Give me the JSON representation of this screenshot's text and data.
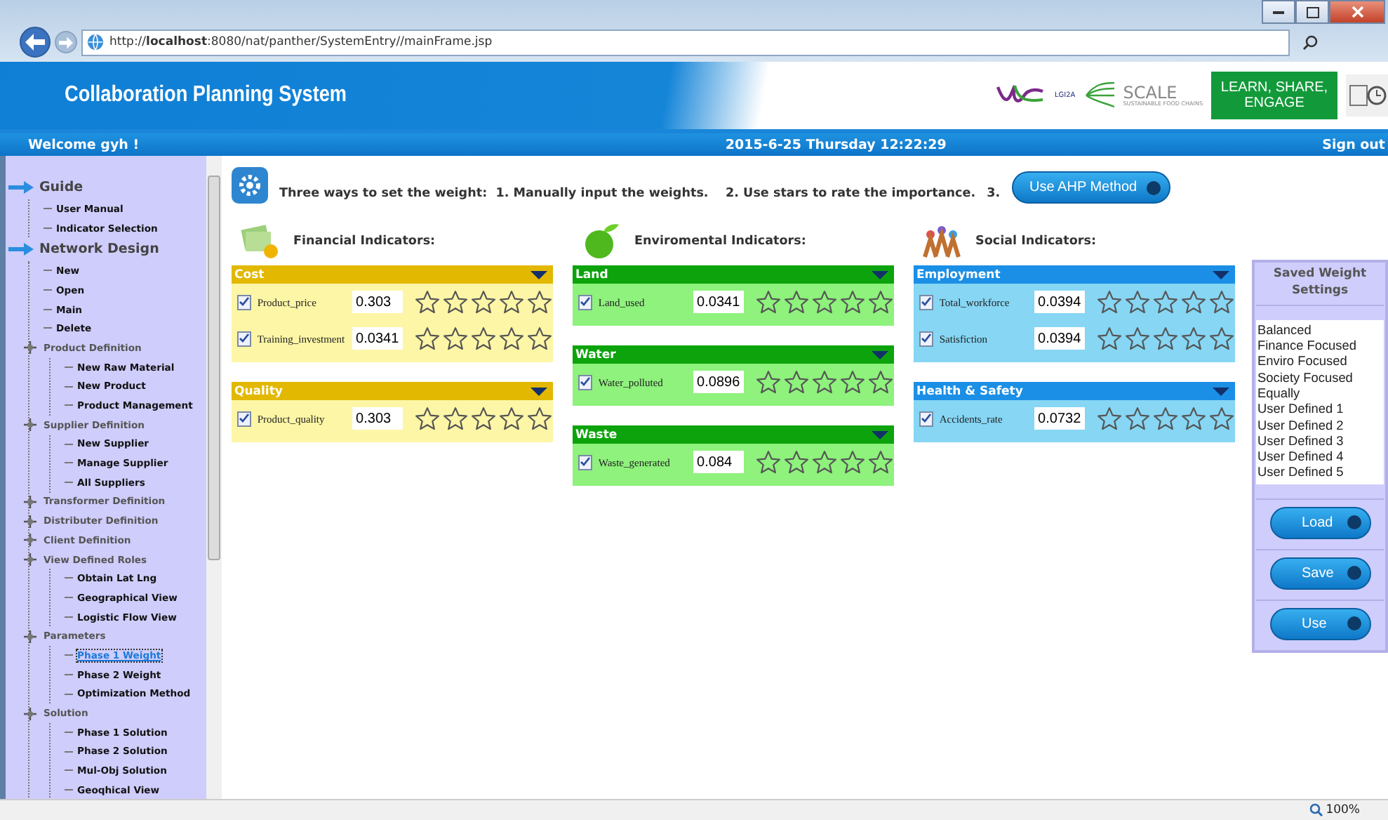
{
  "browser": {
    "url": "http://**localhost**:8080/nat/panther/SystemEntry//mainFrame.jsp",
    "zoom": "100%"
  },
  "header": {
    "title": "Collaboration Planning System",
    "logo_small": "LGI2A",
    "logo_scale": "SCALE",
    "logo_scale_sub": "SUSTAINABLE FOOD CHAINS",
    "banner": "LEARN, SHARE, ENGAGE"
  },
  "welcome_bar": {
    "welcome": "Welcome gyh !",
    "datetime": "2015-6-25 Thursday 12:22:29",
    "sign_out": "Sign out"
  },
  "sidebar": {
    "tree": [
      {
        "kind": "section",
        "label": "Guide",
        "selected": false,
        "children": [
          {
            "kind": "leaf",
            "label": "User Manual",
            "selected": false
          },
          {
            "kind": "leaf",
            "label": "Indicator Selection",
            "selected": false
          }
        ]
      },
      {
        "kind": "section",
        "label": "Network Design",
        "selected": false,
        "children": [
          {
            "kind": "leaf",
            "label": "New",
            "selected": false
          },
          {
            "kind": "leaf",
            "label": "Open",
            "selected": false
          },
          {
            "kind": "leaf",
            "label": "Main",
            "selected": false
          },
          {
            "kind": "leaf",
            "label": "Delete",
            "selected": false
          },
          {
            "kind": "folder",
            "label": "Product Definition",
            "selected": false,
            "children": [
              {
                "kind": "leaf",
                "label": "New Raw Material",
                "selected": false
              },
              {
                "kind": "leaf",
                "label": "New Product",
                "selected": false
              },
              {
                "kind": "leaf",
                "label": "Product Management",
                "selected": false
              }
            ]
          },
          {
            "kind": "folder",
            "label": "Supplier Definition",
            "selected": false,
            "children": [
              {
                "kind": "leaf",
                "label": "New Supplier",
                "selected": false
              },
              {
                "kind": "leaf",
                "label": "Manage Supplier",
                "selected": false
              },
              {
                "kind": "leaf",
                "label": "All Suppliers",
                "selected": false
              }
            ]
          },
          {
            "kind": "folder",
            "label": "Transformer Definition",
            "selected": false
          },
          {
            "kind": "folder",
            "label": "Distributer Definition",
            "selected": false
          },
          {
            "kind": "folder",
            "label": "Client Definition",
            "selected": false
          },
          {
            "kind": "folder",
            "label": "View Defined Roles",
            "selected": false,
            "children": [
              {
                "kind": "leaf",
                "label": "Obtain Lat Lng",
                "selected": false
              },
              {
                "kind": "leaf",
                "label": "Geographical View",
                "selected": false
              },
              {
                "kind": "leaf",
                "label": "Logistic Flow View",
                "selected": false
              }
            ]
          },
          {
            "kind": "folder",
            "label": "Parameters",
            "selected": false,
            "children": [
              {
                "kind": "leaf",
                "label": "Phase 1 Weight",
                "selected": true
              },
              {
                "kind": "leaf",
                "label": "Phase 2 Weight",
                "selected": false
              },
              {
                "kind": "leaf",
                "label": "Optimization Method",
                "selected": false
              }
            ]
          },
          {
            "kind": "folder",
            "label": "Solution",
            "selected": false,
            "children": [
              {
                "kind": "leaf",
                "label": "Phase 1 Solution",
                "selected": false
              },
              {
                "kind": "leaf",
                "label": "Phase 2 Solution",
                "selected": false
              },
              {
                "kind": "leaf",
                "label": "Mul-Obj Solution",
                "selected": false
              },
              {
                "kind": "leaf",
                "label": "Geoqhical View",
                "selected": false
              }
            ]
          }
        ]
      }
    ]
  },
  "intro": {
    "text": "Three ways to set the weight:  1. Manually input the weights.    2. Use stars to rate the importance.",
    "step": "3.",
    "ahp_button": "Use AHP Method"
  },
  "groups": [
    {
      "kind": "financial",
      "title": "Financial Indicators:",
      "panels": [
        {
          "title": "Cost",
          "rows": [
            {
              "label": "Product_price",
              "checked": true,
              "value": "0.303",
              "stars": 0
            },
            {
              "label": "Training_investment",
              "checked": true,
              "value": "0.0341",
              "stars": 0
            }
          ]
        },
        {
          "title": "Quality",
          "rows": [
            {
              "label": "Product_quality",
              "checked": true,
              "value": "0.303",
              "stars": 0
            }
          ]
        }
      ]
    },
    {
      "kind": "environmental",
      "title": "Enviromental Indicators:",
      "panels": [
        {
          "title": "Land",
          "rows": [
            {
              "label": "Land_used",
              "checked": true,
              "value": "0.0341",
              "stars": 0
            }
          ]
        },
        {
          "title": "Water",
          "rows": [
            {
              "label": "Water_polluted",
              "checked": true,
              "value": "0.0896",
              "stars": 0
            }
          ]
        },
        {
          "title": "Waste",
          "rows": [
            {
              "label": "Waste_generated",
              "checked": true,
              "value": "0.084",
              "stars": 0
            }
          ]
        }
      ]
    },
    {
      "kind": "social",
      "title": "Social Indicators:",
      "panels": [
        {
          "title": "Employment",
          "rows": [
            {
              "label": "Total_workforce",
              "checked": true,
              "value": "0.0394",
              "stars": 0
            },
            {
              "label": "Satisfiction",
              "checked": true,
              "value": "0.0394",
              "stars": 0
            }
          ]
        },
        {
          "title": "Health & Safety",
          "rows": [
            {
              "label": "Accidents_rate",
              "checked": true,
              "value": "0.0732",
              "stars": 0
            }
          ]
        }
      ]
    }
  ],
  "saved_settings": {
    "title": "Saved Weight Settings",
    "options": [
      "Balanced",
      "Finance Focused",
      "Enviro Focused",
      "Society Focused",
      "Equally",
      "User Defined 1",
      "User Defined 2",
      "User Defined 3",
      "User Defined 4",
      "User Defined 5"
    ],
    "buttons": [
      "Load",
      "Save",
      "Use"
    ]
  }
}
